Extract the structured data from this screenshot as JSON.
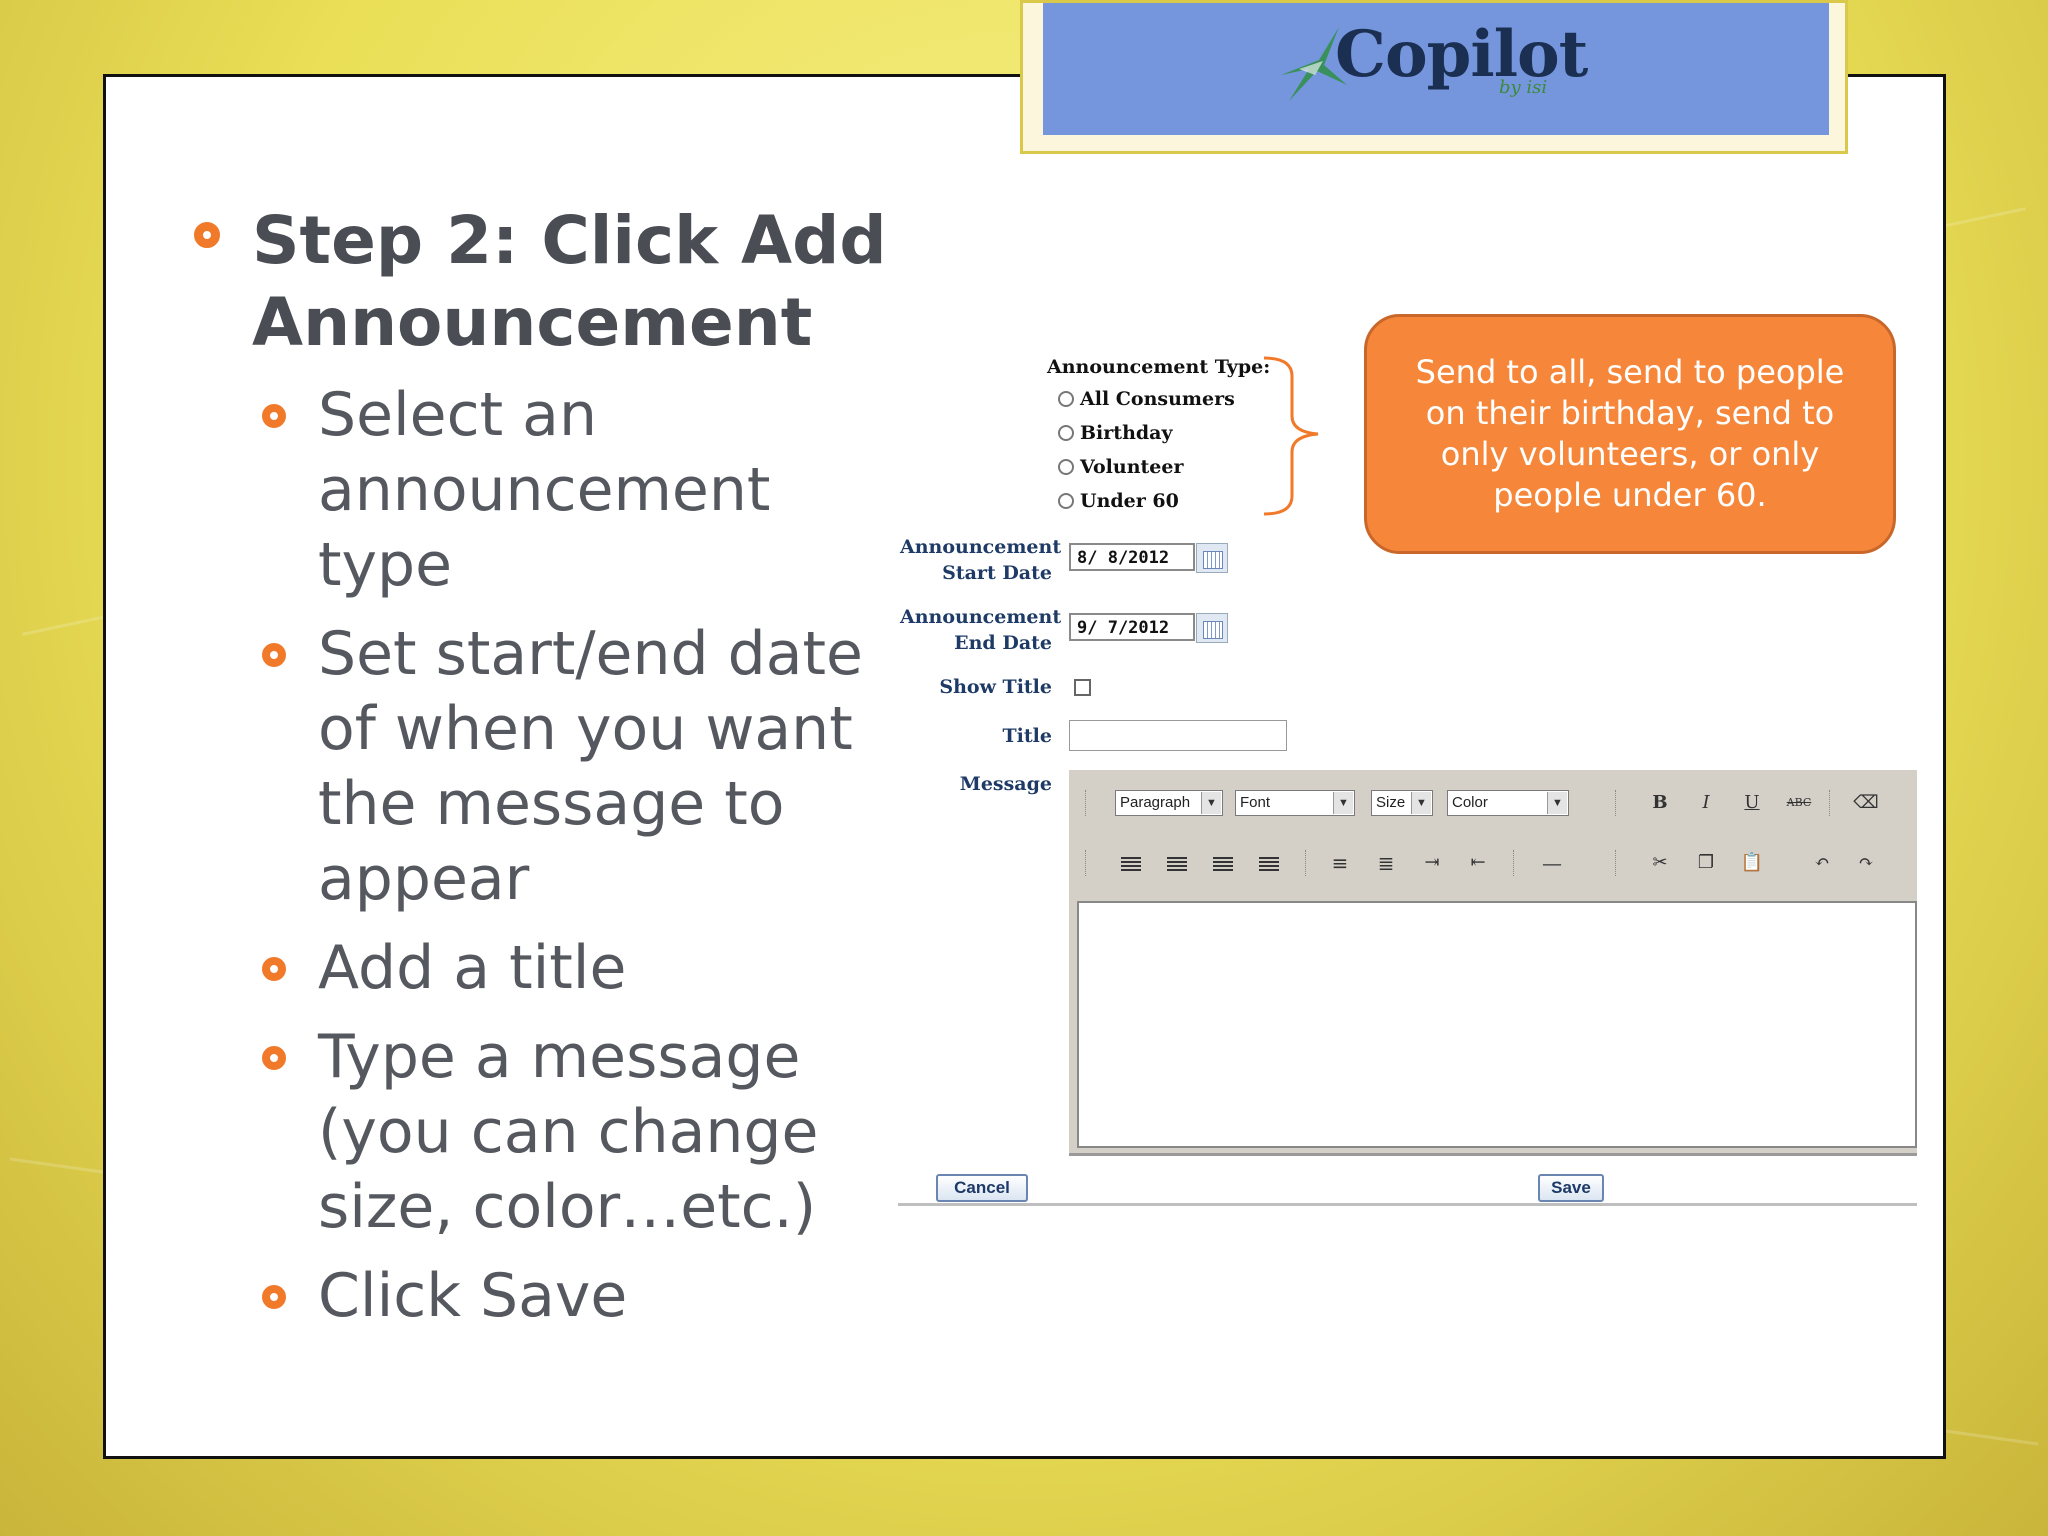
{
  "logo": {
    "brand": "Copilot",
    "tagline": "by isi"
  },
  "heading": "Step 2: Click Add Announcement",
  "steps": [
    "Select an announcement type",
    "Set start/end date of when you want the message to appear",
    "Add a title",
    "Type a message (you can change size, color…etc.)",
    "Click Save"
  ],
  "form": {
    "type_label": "Announcement Type:",
    "types": [
      "All Consumers",
      "Birthday",
      "Volunteer",
      "Under 60"
    ],
    "start_label_1": "Announcement",
    "start_label_2": "Start Date",
    "start_value": "8/ 8/2012",
    "end_label_1": "Announcement",
    "end_label_2": "End Date",
    "end_value": "9/ 7/2012",
    "show_title_label": "Show Title",
    "title_label": "Title",
    "title_value": "",
    "message_label": "Message",
    "toolbar": {
      "paragraph": "Paragraph",
      "font": "Font",
      "size": "Size",
      "color": "Color",
      "bold": "B",
      "italic": "I",
      "underline": "U",
      "strike": "ABC"
    },
    "cancel_label": "Cancel",
    "save_label": "Save"
  },
  "callout_text": "Send to all, send to people on their birthday, send to only volunteers, or only people under 60.",
  "colors": {
    "accent": "#f07a2a",
    "callout": "#f6873a",
    "logo_bg": "#7596dc"
  }
}
